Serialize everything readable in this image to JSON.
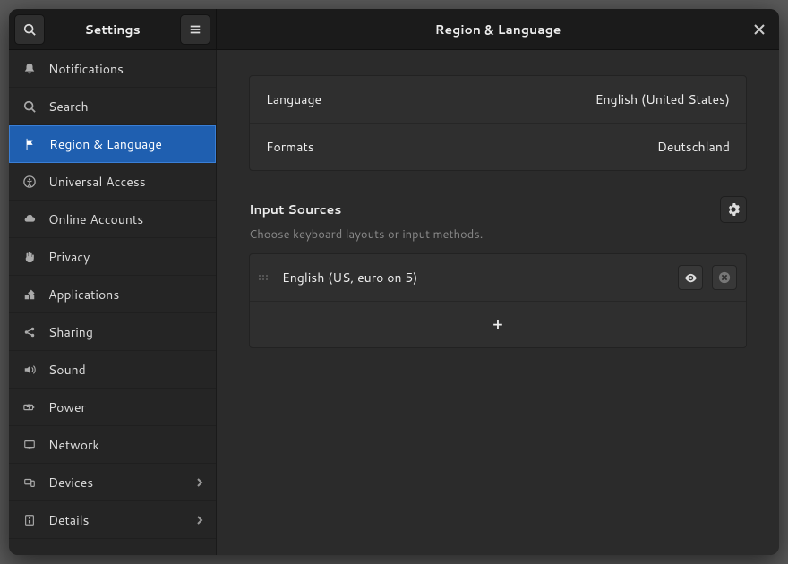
{
  "header": {
    "app_title": "Settings",
    "page_title": "Region & Language"
  },
  "sidebar": {
    "items": [
      {
        "icon": "bell",
        "label": "Notifications"
      },
      {
        "icon": "search",
        "label": "Search"
      },
      {
        "icon": "flag",
        "label": "Region & Language",
        "selected": true
      },
      {
        "icon": "access",
        "label": "Universal Access"
      },
      {
        "icon": "cloud",
        "label": "Online Accounts"
      },
      {
        "icon": "hand",
        "label": "Privacy"
      },
      {
        "icon": "apps",
        "label": "Applications"
      },
      {
        "icon": "share",
        "label": "Sharing"
      },
      {
        "icon": "sound",
        "label": "Sound"
      },
      {
        "icon": "power",
        "label": "Power"
      },
      {
        "icon": "network",
        "label": "Network"
      },
      {
        "icon": "devices",
        "label": "Devices",
        "chevron": true
      },
      {
        "icon": "details",
        "label": "Details",
        "chevron": true
      }
    ]
  },
  "main": {
    "language_label": "Language",
    "language_value": "English (United States)",
    "formats_label": "Formats",
    "formats_value": "Deutschland",
    "input_sources_title": "Input Sources",
    "input_sources_subtitle": "Choose keyboard layouts or input methods.",
    "input_sources": [
      {
        "name": "English (US, euro on 5)"
      }
    ],
    "add_label": "+"
  }
}
